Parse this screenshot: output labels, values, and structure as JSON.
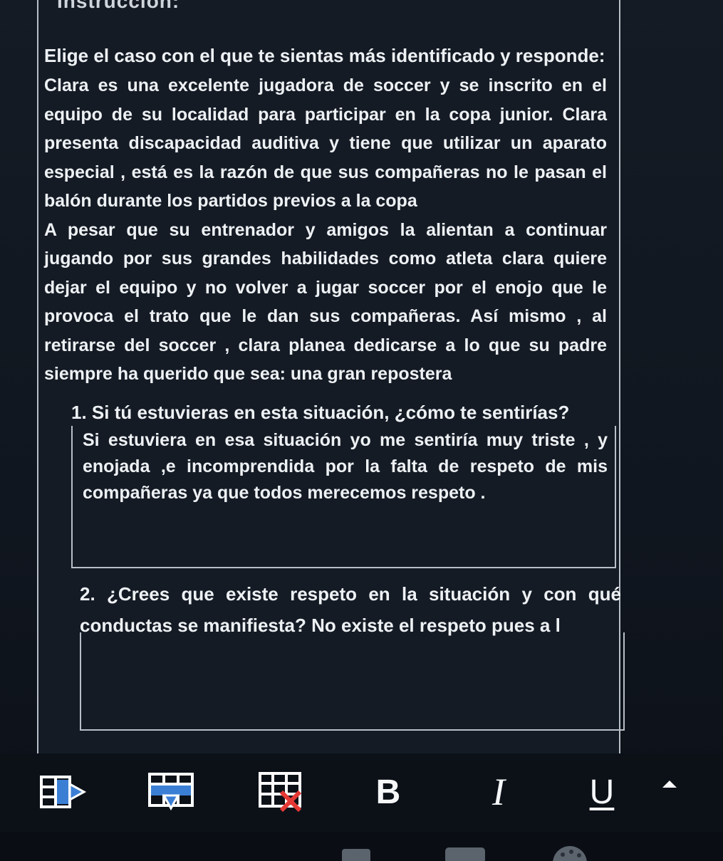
{
  "document": {
    "title": "Instrucción:",
    "intro_heading": "Elige el caso con el que te sientas más identificado y responde:",
    "case_paragraph_1": "Clara es una excelente jugadora de soccer y se inscrito en el equipo de su localidad para participar  en la copa  junior. Clara presenta discapacidad auditiva  y tiene que utilizar un aparato especial , está es la razón de que sus compañeras  no le pasan el balón  durante los partidos previos a la copa",
    "case_paragraph_2": "A pesar que su entrenador y amigos la alientan a  continuar jugando por sus grandes habilidades como atleta  clara quiere dejar el equipo y no volver a jugar soccer por el enojo que le provoca el trato que le dan sus compañeras. Así mismo , al retirarse del soccer , clara planea dedicarse a lo que su padre siempre ha querido que sea: una gran repostera"
  },
  "question_1": {
    "text": "1. Si tú estuvieras en esta situación, ¿cómo te sentirías?",
    "answer": "Si estuviera en esa situación yo me sentiría muy triste , y enojada ,e incomprendida  por la falta de respeto  de mis compañeras ya que  todos merecemos respeto ."
  },
  "question_2": {
    "text": "2. ¿Crees que existe respeto en la situación y con qué conductas se manifiesta?",
    "answer": "No existe el respeto  pues a l"
  },
  "toolbar": {
    "bold_label": "B",
    "italic_label": "I",
    "underline_label": "U",
    "icons": [
      "insert-column-icon",
      "insert-row-icon",
      "delete-table-icon",
      "bold-icon",
      "italic-icon",
      "underline-icon",
      "collapse-arrow-icon"
    ]
  },
  "colors": {
    "background": "#141b25",
    "text": "#eef1f4",
    "border": "#b8bfc7",
    "accent_blue": "#3b7fd4"
  }
}
